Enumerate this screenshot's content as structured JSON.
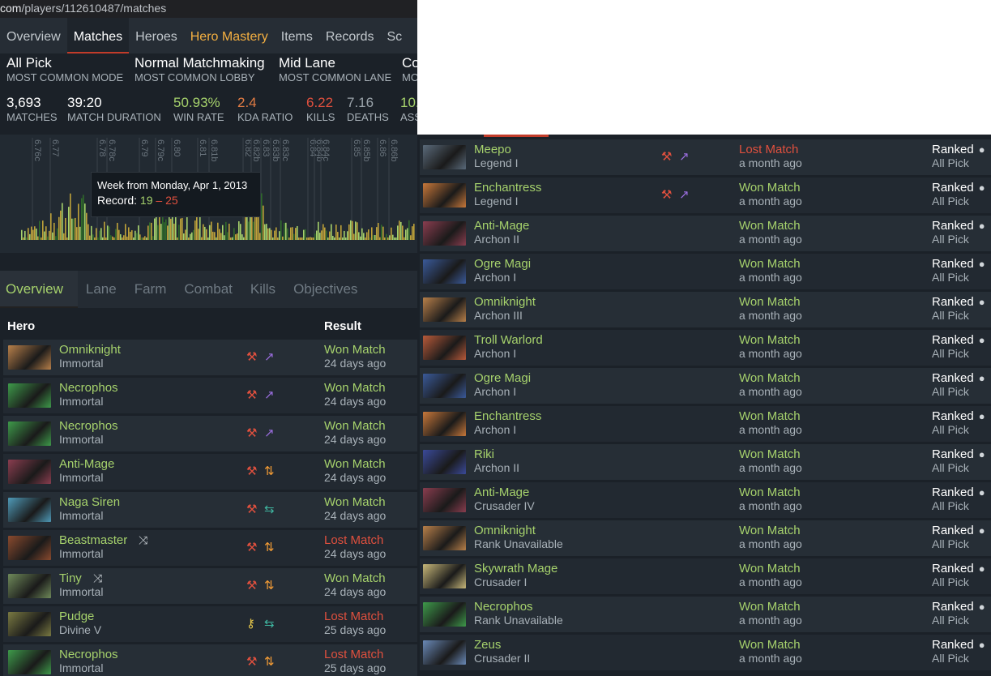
{
  "url": {
    "host": "com",
    "path": "/players/112610487/matches"
  },
  "nav": {
    "tabs": [
      {
        "label": "Overview"
      },
      {
        "label": "Matches"
      },
      {
        "label": "Heroes"
      },
      {
        "label": "Hero Mastery"
      },
      {
        "label": "Items"
      },
      {
        "label": "Records"
      },
      {
        "label": "Sc"
      }
    ],
    "active": "Matches"
  },
  "summary": {
    "mode": {
      "value": "All Pick",
      "key": "MOST COMMON MODE"
    },
    "lobby": {
      "value": "Normal Matchmaking",
      "key": "MOST COMMON LOBBY"
    },
    "lane": {
      "value": "Mid Lane",
      "key": "MOST COMMON LANE"
    },
    "cut": {
      "value": "Co",
      "key": "MO"
    }
  },
  "stats": {
    "matches": {
      "value": "3,693",
      "key": "MATCHES"
    },
    "duration": {
      "value": "39:20",
      "key": "MATCH DURATION"
    },
    "winrate": {
      "value": "50.93%",
      "key": "WIN RATE"
    },
    "kda": {
      "value": "2.4",
      "key": "KDA RATIO"
    },
    "kills": {
      "value": "6.22",
      "key": "KILLS"
    },
    "deaths": {
      "value": "7.16",
      "key": "DEATHS"
    },
    "assists": {
      "value": "10.",
      "key": "ASS"
    }
  },
  "chart": {
    "patch_labels": [
      "6.76c",
      "6.77",
      "6.78",
      "6.78c",
      "6.79",
      "6.79c",
      "6.80",
      "6.81",
      "6.81b",
      "6.82",
      "6.82b",
      "6.83",
      "6.83b",
      "6.83c",
      "6.84",
      "6.84b",
      "6.84c",
      "6.85",
      "6.85b",
      "6.86",
      "6.86b"
    ],
    "tooltip": {
      "title": "Week from Monday, Apr 1, 2013",
      "record_label": "Record:",
      "wins": "19",
      "sep": "–",
      "losses": "25"
    },
    "colors": {
      "win": "#a6d26c",
      "loss": "#e0503e",
      "neutral": "#bfa23a"
    }
  },
  "subtabs": {
    "items": [
      {
        "label": "Overview"
      },
      {
        "label": "Lane"
      },
      {
        "label": "Farm"
      },
      {
        "label": "Combat"
      },
      {
        "label": "Kills"
      },
      {
        "label": "Objectives"
      }
    ],
    "active": "Overview"
  },
  "table": {
    "col_hero": "Hero",
    "col_result": "Result"
  },
  "left_rows": [
    {
      "hero": "Omniknight",
      "rank": "Immortal",
      "result": "Won Match",
      "win": true,
      "when": "24 days ago",
      "role": "axe",
      "lane": "sword",
      "random": false,
      "color": "#b8804a"
    },
    {
      "hero": "Necrophos",
      "rank": "Immortal",
      "result": "Won Match",
      "win": true,
      "when": "24 days ago",
      "role": "axe",
      "lane": "sword",
      "random": false,
      "color": "#3e9a4a"
    },
    {
      "hero": "Necrophos",
      "rank": "Immortal",
      "result": "Won Match",
      "win": true,
      "when": "24 days ago",
      "role": "axe",
      "lane": "sword",
      "random": false,
      "color": "#3e9a4a"
    },
    {
      "hero": "Anti-Mage",
      "rank": "Immortal",
      "result": "Won Match",
      "win": true,
      "when": "24 days ago",
      "role": "axe",
      "lane": "updown",
      "random": false,
      "color": "#8a3d4f"
    },
    {
      "hero": "Naga Siren",
      "rank": "Immortal",
      "result": "Won Match",
      "win": true,
      "when": "24 days ago",
      "role": "axe",
      "lane": "swap",
      "random": false,
      "color": "#4f9ab8"
    },
    {
      "hero": "Beastmaster",
      "rank": "Immortal",
      "result": "Lost Match",
      "win": false,
      "when": "24 days ago",
      "role": "axe",
      "lane": "updown",
      "random": true,
      "color": "#8a4a2e"
    },
    {
      "hero": "Tiny",
      "rank": "Immortal",
      "result": "Won Match",
      "win": true,
      "when": "24 days ago",
      "role": "axe",
      "lane": "updown",
      "random": true,
      "color": "#6f8a5a"
    },
    {
      "hero": "Pudge",
      "rank": "Divine V",
      "result": "Lost Match",
      "win": false,
      "when": "25 days ago",
      "role": "key",
      "lane": "swap",
      "random": false,
      "color": "#7a7a42"
    },
    {
      "hero": "Necrophos",
      "rank": "Immortal",
      "result": "Lost Match",
      "win": false,
      "when": "25 days ago",
      "role": "axe",
      "lane": "updown",
      "random": false,
      "color": "#3e9a4a"
    }
  ],
  "right_rows": [
    {
      "hero": "Meepo",
      "rank": "Legend I",
      "result": "Lost Match",
      "win": false,
      "when": "a month ago",
      "type": "Ranked",
      "mode": "All Pick",
      "icons": true,
      "color": "#5a6a7a"
    },
    {
      "hero": "Enchantress",
      "rank": "Legend I",
      "result": "Won Match",
      "win": true,
      "when": "a month ago",
      "type": "Ranked",
      "mode": "All Pick",
      "icons": true,
      "color": "#c8783a"
    },
    {
      "hero": "Anti-Mage",
      "rank": "Archon II",
      "result": "Won Match",
      "win": true,
      "when": "a month ago",
      "type": "Ranked",
      "mode": "All Pick",
      "icons": false,
      "color": "#8a3d4f"
    },
    {
      "hero": "Ogre Magi",
      "rank": "Archon I",
      "result": "Won Match",
      "win": true,
      "when": "a month ago",
      "type": "Ranked",
      "mode": "All Pick",
      "icons": false,
      "color": "#3a5a9a"
    },
    {
      "hero": "Omniknight",
      "rank": "Archon III",
      "result": "Won Match",
      "win": true,
      "when": "a month ago",
      "type": "Ranked",
      "mode": "All Pick",
      "icons": false,
      "color": "#b8804a"
    },
    {
      "hero": "Troll Warlord",
      "rank": "Archon I",
      "result": "Won Match",
      "win": true,
      "when": "a month ago",
      "type": "Ranked",
      "mode": "All Pick",
      "icons": false,
      "color": "#b85a3a"
    },
    {
      "hero": "Ogre Magi",
      "rank": "Archon I",
      "result": "Won Match",
      "win": true,
      "when": "a month ago",
      "type": "Ranked",
      "mode": "All Pick",
      "icons": false,
      "color": "#3a5a9a"
    },
    {
      "hero": "Enchantress",
      "rank": "Archon I",
      "result": "Won Match",
      "win": true,
      "when": "a month ago",
      "type": "Ranked",
      "mode": "All Pick",
      "icons": false,
      "color": "#c8783a"
    },
    {
      "hero": "Riki",
      "rank": "Archon II",
      "result": "Won Match",
      "win": true,
      "when": "a month ago",
      "type": "Ranked",
      "mode": "All Pick",
      "icons": false,
      "color": "#3a4a9a"
    },
    {
      "hero": "Anti-Mage",
      "rank": "Crusader IV",
      "result": "Won Match",
      "win": true,
      "when": "a month ago",
      "type": "Ranked",
      "mode": "All Pick",
      "icons": false,
      "color": "#8a3d4f"
    },
    {
      "hero": "Omniknight",
      "rank": "Rank Unavailable",
      "result": "Won Match",
      "win": true,
      "when": "a month ago",
      "type": "Ranked",
      "mode": "All Pick",
      "icons": false,
      "color": "#b8804a"
    },
    {
      "hero": "Skywrath Mage",
      "rank": "Crusader I",
      "result": "Won Match",
      "win": true,
      "when": "a month ago",
      "type": "Ranked",
      "mode": "All Pick",
      "icons": false,
      "color": "#c8b87a"
    },
    {
      "hero": "Necrophos",
      "rank": "Rank Unavailable",
      "result": "Won Match",
      "win": true,
      "when": "a month ago",
      "type": "Ranked",
      "mode": "All Pick",
      "icons": false,
      "color": "#3e9a4a"
    },
    {
      "hero": "Zeus",
      "rank": "Crusader II",
      "result": "Won Match",
      "win": true,
      "when": "a month ago",
      "type": "Ranked",
      "mode": "All Pick",
      "icons": false,
      "color": "#6a8ab8"
    }
  ]
}
